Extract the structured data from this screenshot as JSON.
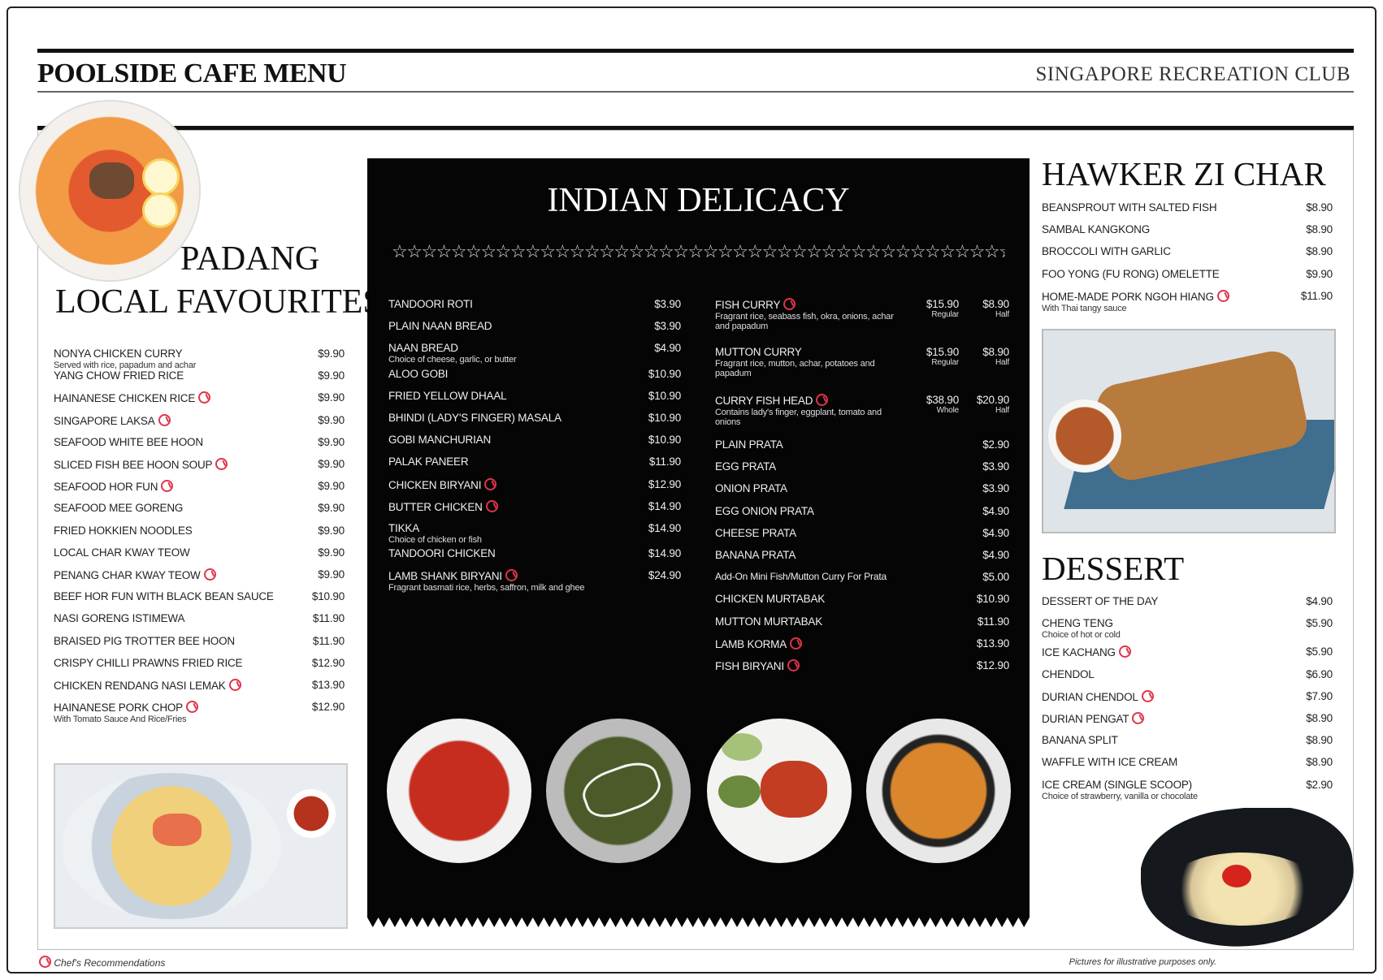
{
  "header": {
    "title": "POOLSIDE CAFE MENU",
    "club": "SINGAPORE RECREATION CLUB"
  },
  "padang": {
    "title1": "PADANG",
    "title2": "LOCAL FAVOURITES",
    "items": [
      {
        "name": "NONYA CHICKEN CURRY",
        "desc": "Served with rice, papadum and achar",
        "price": "$9.90",
        "rec": false
      },
      {
        "name": "YANG CHOW FRIED RICE",
        "desc": "",
        "price": "$9.90",
        "rec": false
      },
      {
        "name": "HAINANESE CHICKEN RICE",
        "desc": "",
        "price": "$9.90",
        "rec": true
      },
      {
        "name": "SINGAPORE LAKSA",
        "desc": "",
        "price": "$9.90",
        "rec": true
      },
      {
        "name": "SEAFOOD WHITE BEE HOON",
        "desc": "",
        "price": "$9.90",
        "rec": false
      },
      {
        "name": "SLICED FISH BEE HOON SOUP",
        "desc": "",
        "price": "$9.90",
        "rec": true
      },
      {
        "name": "SEAFOOD HOR FUN",
        "desc": "",
        "price": "$9.90",
        "rec": true
      },
      {
        "name": "SEAFOOD MEE GORENG",
        "desc": "",
        "price": "$9.90",
        "rec": false
      },
      {
        "name": "FRIED HOKKIEN NOODLES",
        "desc": "",
        "price": "$9.90",
        "rec": false
      },
      {
        "name": "LOCAL CHAR KWAY TEOW",
        "desc": "",
        "price": "$9.90",
        "rec": false
      },
      {
        "name": "PENANG CHAR KWAY TEOW",
        "desc": "",
        "price": "$9.90",
        "rec": true
      },
      {
        "name": "BEEF HOR FUN WITH BLACK BEAN SAUCE",
        "desc": "",
        "price": "$10.90",
        "rec": false
      },
      {
        "name": "NASI GORENG ISTIMEWA",
        "desc": "",
        "price": "$11.90",
        "rec": false
      },
      {
        "name": "BRAISED PIG TROTTER BEE HOON",
        "desc": "",
        "price": "$11.90",
        "rec": false
      },
      {
        "name": "CRISPY CHILLI PRAWNS FRIED RICE",
        "desc": "",
        "price": "$12.90",
        "rec": false
      },
      {
        "name": "CHICKEN RENDANG NASI LEMAK",
        "desc": "",
        "price": "$13.90",
        "rec": true
      },
      {
        "name": "HAINANESE PORK CHOP",
        "desc": "With Tomato Sauce And Rice/Fries",
        "price": "$12.90",
        "rec": true
      }
    ]
  },
  "indian": {
    "title": "INDIAN DELICACY",
    "stars": "☆☆☆☆☆☆☆☆☆☆☆☆☆☆☆☆☆☆☆☆☆☆☆☆☆☆☆☆☆☆☆☆☆☆☆☆☆☆☆☆☆☆☆☆☆☆☆☆",
    "left": [
      {
        "name": "TANDOORI ROTI",
        "desc": "",
        "price": "$3.90",
        "rec": false
      },
      {
        "name": "PLAIN NAAN BREAD",
        "desc": "",
        "price": "$3.90",
        "rec": false
      },
      {
        "name": "NAAN BREAD",
        "desc": "Choice of cheese, garlic, or butter",
        "price": "$4.90",
        "rec": false
      },
      {
        "name": "ALOO GOBI",
        "desc": "",
        "price": "$10.90",
        "rec": false
      },
      {
        "name": "FRIED YELLOW DHAAL",
        "desc": "",
        "price": "$10.90",
        "rec": false
      },
      {
        "name": "BHINDI (LADY'S FINGER) MASALA",
        "desc": "",
        "price": "$10.90",
        "rec": false
      },
      {
        "name": "GOBI MANCHURIAN",
        "desc": "",
        "price": "$10.90",
        "rec": false
      },
      {
        "name": "PALAK PANEER",
        "desc": "",
        "price": "$11.90",
        "rec": false
      },
      {
        "name": "CHICKEN BIRYANI",
        "desc": "",
        "price": "$12.90",
        "rec": true
      },
      {
        "name": "BUTTER CHICKEN",
        "desc": "",
        "price": "$14.90",
        "rec": true
      },
      {
        "name": "TIKKA",
        "desc": "Choice of chicken or fish",
        "price": "$14.90",
        "rec": false
      },
      {
        "name": "TANDOORI CHICKEN",
        "desc": "",
        "price": "$14.90",
        "rec": false
      },
      {
        "name": "LAMB SHANK BIRYANI",
        "desc": "Fragrant basmati rice, herbs, saffron, milk and ghee",
        "price": "$24.90",
        "rec": true
      }
    ],
    "right_dual": [
      {
        "name": "FISH CURRY",
        "desc": "Fragrant rice, seabass fish, okra, onions, achar and papadum",
        "p1": "$15.90",
        "t1": "Regular",
        "p2": "$8.90",
        "t2": "Half",
        "rec": true
      },
      {
        "name": "MUTTON CURRY",
        "desc": "Fragrant rice, mutton, achar, potatoes and papadum",
        "p1": "$15.90",
        "t1": "Regular",
        "p2": "$8.90",
        "t2": "Half",
        "rec": false
      },
      {
        "name": "CURRY FISH HEAD",
        "desc": "Contains lady's finger, eggplant, tomato and onions",
        "p1": "$38.90",
        "t1": "Whole",
        "p2": "$20.90",
        "t2": "Half",
        "rec": true
      }
    ],
    "right": [
      {
        "name": "PLAIN PRATA",
        "price": "$2.90",
        "rec": false
      },
      {
        "name": "EGG PRATA",
        "price": "$3.90",
        "rec": false
      },
      {
        "name": "ONION PRATA",
        "price": "$3.90",
        "rec": false
      },
      {
        "name": "EGG ONION PRATA",
        "price": "$4.90",
        "rec": false
      },
      {
        "name": "CHEESE PRATA",
        "price": "$4.90",
        "rec": false
      },
      {
        "name": "BANANA PRATA",
        "price": "$4.90",
        "rec": false
      },
      {
        "name": "Add-On Mini Fish/Mutton Curry For Prata",
        "price": "$5.00",
        "rec": false
      },
      {
        "name": "CHICKEN MURTABAK",
        "price": "$10.90",
        "rec": false
      },
      {
        "name": "MUTTON MURTABAK",
        "price": "$11.90",
        "rec": false
      },
      {
        "name": "LAMB KORMA",
        "price": "$13.90",
        "rec": true
      },
      {
        "name": "FISH BIRYANI",
        "price": "$12.90",
        "rec": true
      }
    ]
  },
  "hawker": {
    "title": "HAWKER ZI CHAR",
    "items": [
      {
        "name": "BEANSPROUT WITH SALTED FISH",
        "desc": "",
        "price": "$8.90",
        "rec": false
      },
      {
        "name": "SAMBAL KANGKONG",
        "desc": "",
        "price": "$8.90",
        "rec": false
      },
      {
        "name": "BROCCOLI WITH GARLIC",
        "desc": "",
        "price": "$8.90",
        "rec": false
      },
      {
        "name": "FOO YONG (Fu Rong) OMELETTE",
        "desc": "",
        "price": "$9.90",
        "rec": false
      },
      {
        "name": "HOME-MADE PORK NGOH HIANG",
        "desc": "With Thai tangy sauce",
        "price": "$11.90",
        "rec": true
      }
    ]
  },
  "dessert": {
    "title": "DESSERT",
    "items": [
      {
        "name": "DESSERT OF THE DAY",
        "desc": "",
        "price": "$4.90",
        "rec": false
      },
      {
        "name": "CHENG TENG",
        "desc": "Choice of hot or cold",
        "price": "$5.90",
        "rec": false
      },
      {
        "name": "ICE KACHANG",
        "desc": "",
        "price": "$5.90",
        "rec": true
      },
      {
        "name": "CHENDOL",
        "desc": "",
        "price": "$6.90",
        "rec": false
      },
      {
        "name": "DURIAN CHENDOL",
        "desc": "",
        "price": "$7.90",
        "rec": true
      },
      {
        "name": "DURIAN PENGAT",
        "desc": "",
        "price": "$8.90",
        "rec": true
      },
      {
        "name": "BANANA SPLIT",
        "desc": "",
        "price": "$8.90",
        "rec": false
      },
      {
        "name": "WAFFLE WITH ICE CREAM",
        "desc": "",
        "price": "$8.90",
        "rec": false
      },
      {
        "name": "ICE CREAM (SINGLE SCOOP)",
        "desc": "Choice of strawberry, vanilla or chocolate",
        "price": "$2.90",
        "rec": false
      }
    ]
  },
  "footer": {
    "legend": "Chef's Recommendations",
    "note": "Pictures for illustrative purposes only."
  },
  "colors": {
    "accent": "#e0344a",
    "panel": "#050505"
  }
}
